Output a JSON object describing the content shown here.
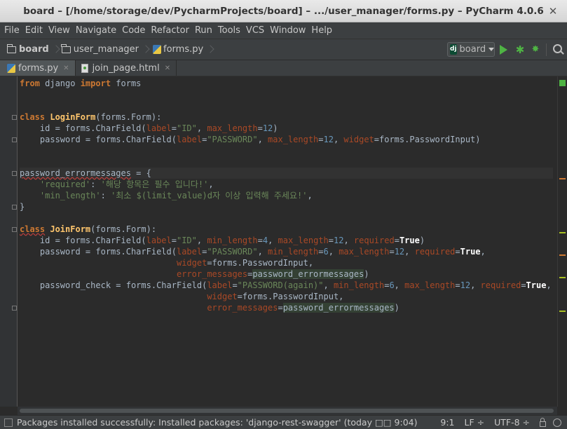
{
  "window": {
    "title": "board – [/home/storage/dev/PycharmProjects/board] – .../user_manager/forms.py – PyCharm 4.0.6"
  },
  "menu": [
    "File",
    "Edit",
    "View",
    "Navigate",
    "Code",
    "Refactor",
    "Run",
    "Tools",
    "VCS",
    "Window",
    "Help"
  ],
  "breadcrumbs": [
    "board",
    "user_manager",
    "forms.py"
  ],
  "run_config": {
    "label": "board",
    "badge": "dj"
  },
  "tabs": [
    {
      "label": "forms.py",
      "active": true
    },
    {
      "label": "join_page.html",
      "active": false
    }
  ],
  "code": {
    "t1": "from",
    "t2": " django ",
    "t3": "import",
    "t4": " forms",
    "l4_class": "class",
    "l4_name": "LoginForm",
    "l4_rest": "(forms.Form):",
    "l5a": "    id = forms.CharField(",
    "l5b": "label",
    "l5c": "=",
    "l5d": "\"ID\"",
    "l5e": ", ",
    "l5f": "max_length",
    "l5g": "=",
    "l5h": "12",
    "l5i": ")",
    "l6a": "    password = forms.CharField(",
    "l6b": "label",
    "l6c": "=",
    "l6d": "\"PASSWORD\"",
    "l6e": ", ",
    "l6f": "max_length",
    "l6g": "=",
    "l6h": "12",
    "l6i": ", ",
    "l6j": "widget",
    "l6k": "=forms.PasswordInput)",
    "l9a": "password_errormessages",
    "l9b": " = {",
    "l10a": "    ",
    "l10b": "'required'",
    "l10c": ": ",
    "l10d": "'해당 항목은 필수 입니다!'",
    "l10e": ",",
    "l11a": "    ",
    "l11b": "'min_length'",
    "l11c": ": ",
    "l11d": "'최소 $(limit_value)d자 이상 입력해 주세요!'",
    "l11e": ",",
    "l12": "}",
    "l14_class": "class",
    "l14_name": "JoinForm",
    "l14_rest": "(forms.Form):",
    "l15a": "    id = forms.CharField(",
    "l15b": "label",
    "l15c": "=",
    "l15d": "\"ID\"",
    "l15e": ", ",
    "l15f": "min_length",
    "l15g": "=",
    "l15h": "4",
    "l15i": ", ",
    "l15j": "max_length",
    "l15k": "=",
    "l15l": "12",
    "l15m": ", ",
    "l15n": "required",
    "l15o": "=",
    "l15p": "True",
    "l15q": ")",
    "l16a": "    password = forms.CharField(",
    "l16b": "label",
    "l16c": "=",
    "l16d": "\"PASSWORD\"",
    "l16e": ", ",
    "l16f": "min_length",
    "l16g": "=",
    "l16h": "6",
    "l16i": ", ",
    "l16j": "max_length",
    "l16k": "=",
    "l16l": "12",
    "l16m": ", ",
    "l16n": "required",
    "l16o": "=",
    "l16p": "True",
    "l16q": ",",
    "l17a": "                               ",
    "l17b": "widget",
    "l17c": "=forms.PasswordInput,",
    "l18a": "                               ",
    "l18b": "error_messages",
    "l18c": "=",
    "l18d": "password_errormessages",
    "l18e": ")",
    "l19a": "    password_check = forms.CharField(",
    "l19b": "label",
    "l19c": "=",
    "l19d": "\"PASSWORD(again)\"",
    "l19e": ", ",
    "l19f": "min_length",
    "l19g": "=",
    "l19h": "6",
    "l19i": ", ",
    "l19j": "max_length",
    "l19k": "=",
    "l19l": "12",
    "l19m": ", ",
    "l19n": "required",
    "l19o": "=",
    "l19p": "True",
    "l19q": ",",
    "l20a": "                                     ",
    "l20b": "widget",
    "l20c": "=forms.PasswordInput,",
    "l21a": "                                     ",
    "l21b": "error_messages",
    "l21c": "=",
    "l21d": "password_errormessages",
    "l21e": ")"
  },
  "status": {
    "message": "Packages installed successfully: Installed packages: 'django-rest-swagger' (today □□ 9:04)",
    "position": "9:1",
    "line_sep": "LF ÷",
    "encoding": "UTF-8 ÷"
  },
  "colors": {
    "keyword": "#cc7832",
    "string": "#6a8759",
    "number": "#6897bb",
    "param": "#aa4926",
    "class_name": "#ffc66d",
    "text": "#a9b7c6"
  }
}
